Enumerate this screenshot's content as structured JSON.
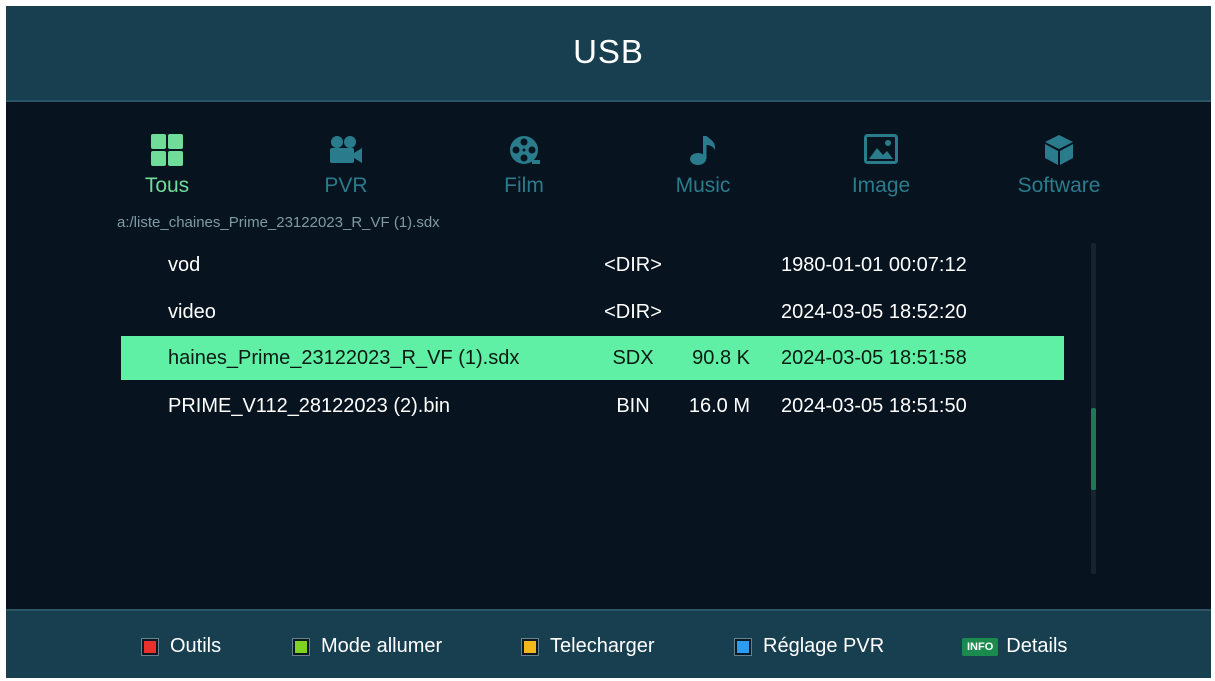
{
  "header": {
    "title": "USB"
  },
  "categories": [
    {
      "label": "Tous",
      "icon": "grid-icon",
      "active": true
    },
    {
      "label": "PVR",
      "icon": "video-camera-icon",
      "active": false
    },
    {
      "label": "Film",
      "icon": "film-reel-icon",
      "active": false
    },
    {
      "label": "Music",
      "icon": "music-note-icon",
      "active": false
    },
    {
      "label": "Image",
      "icon": "image-icon",
      "active": false
    },
    {
      "label": "Software",
      "icon": "package-icon",
      "active": false
    }
  ],
  "path": "a:/liste_chaines_Prime_23122023_R_VF (1).sdx",
  "files": [
    {
      "name": "vod",
      "type": "<DIR>",
      "size": "",
      "date": "1980-01-01 00:07:12"
    },
    {
      "name": "video",
      "type": "<DIR>",
      "size": "",
      "date": "2024-03-05 18:52:20"
    },
    {
      "name": "haines_Prime_23122023_R_VF (1).sdx",
      "type": "SDX",
      "size": "90.8 K",
      "date": "2024-03-05 18:51:58",
      "selected": true
    },
    {
      "name": "PRIME_V112_28122023 (2).bin",
      "type": "BIN",
      "size": "16.0 M",
      "date": "2024-03-05 18:51:50"
    }
  ],
  "footer": {
    "keys": [
      {
        "label": "Outils",
        "color": "#e8302c"
      },
      {
        "label": "Mode allumer",
        "color": "#7ed321"
      },
      {
        "label": "Telecharger",
        "color": "#f5b81c"
      },
      {
        "label": "Réglage PVR",
        "color": "#2d9cf0"
      }
    ],
    "info": {
      "badge": "INFO",
      "label": "Details",
      "color": "#1a8a4e"
    }
  },
  "colors": {
    "accent_active": "#6fdc9a",
    "inactive": "#2a7c8c",
    "selection": "#5ff0a6",
    "header_bg": "#173f50",
    "body_bg": "#07131e"
  }
}
